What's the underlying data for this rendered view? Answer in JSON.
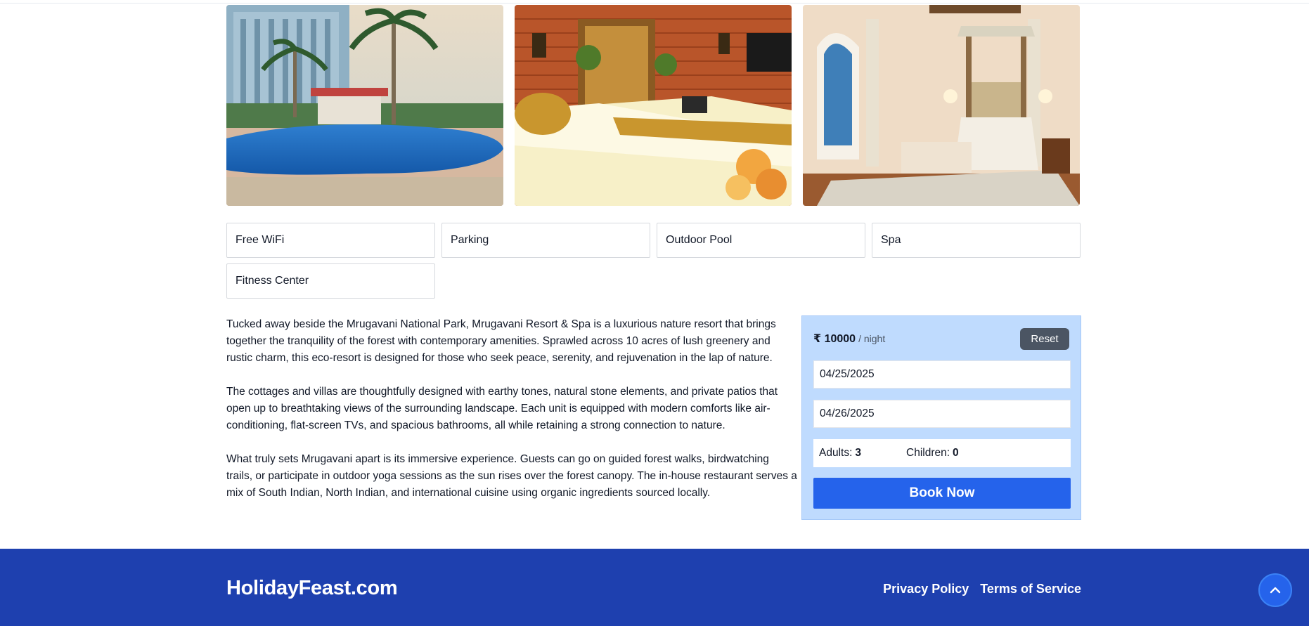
{
  "gallery": {
    "images": [
      {
        "icon": "hotel-pool-photo"
      },
      {
        "icon": "hotel-room-photo"
      },
      {
        "icon": "hotel-suite-photo"
      }
    ]
  },
  "amenities": [
    "Free WiFi",
    "Parking",
    "Outdoor Pool",
    "Spa",
    "Fitness Center"
  ],
  "description": [
    "Tucked away beside the Mrugavani National Park, Mrugavani Resort & Spa is a luxurious nature resort that brings together the tranquility of the forest with contemporary amenities. Sprawled across 10 acres of lush greenery and rustic charm, this eco-resort is designed for those who seek peace, serenity, and rejuvenation in the lap of nature.",
    "The cottages and villas are thoughtfully designed with earthy tones, natural stone elements, and private patios that open up to breathtaking views of the surrounding landscape. Each unit is equipped with modern comforts like air-conditioning, flat-screen TVs, and spacious bathrooms, all while retaining a strong connection to nature.",
    "What truly sets Mrugavani apart is its immersive experience. Guests can go on guided forest walks, birdwatching trails, or participate in outdoor yoga sessions as the sun rises over the forest canopy. The in-house restaurant serves a mix of South Indian, North Indian, and international cuisine using organic ingredients sourced locally."
  ],
  "booking": {
    "price": "₹ 10000",
    "per_night": "/ night",
    "reset_label": "Reset",
    "check_in": "04/25/2025",
    "check_out": "04/26/2025",
    "adults_label": "Adults:",
    "adults_value": "3",
    "children_label": "Children:",
    "children_value": "0",
    "book_label": "Book Now"
  },
  "footer": {
    "brand": "HolidayFeast.com",
    "links": [
      "Privacy Policy",
      "Terms of Service"
    ],
    "scroll_top_icon": "chevron-up-icon"
  },
  "colors": {
    "primary": "#2563eb",
    "footer_bg": "#1e40af",
    "booking_bg": "#bfdbfe",
    "reset_bg": "#4b5563"
  }
}
